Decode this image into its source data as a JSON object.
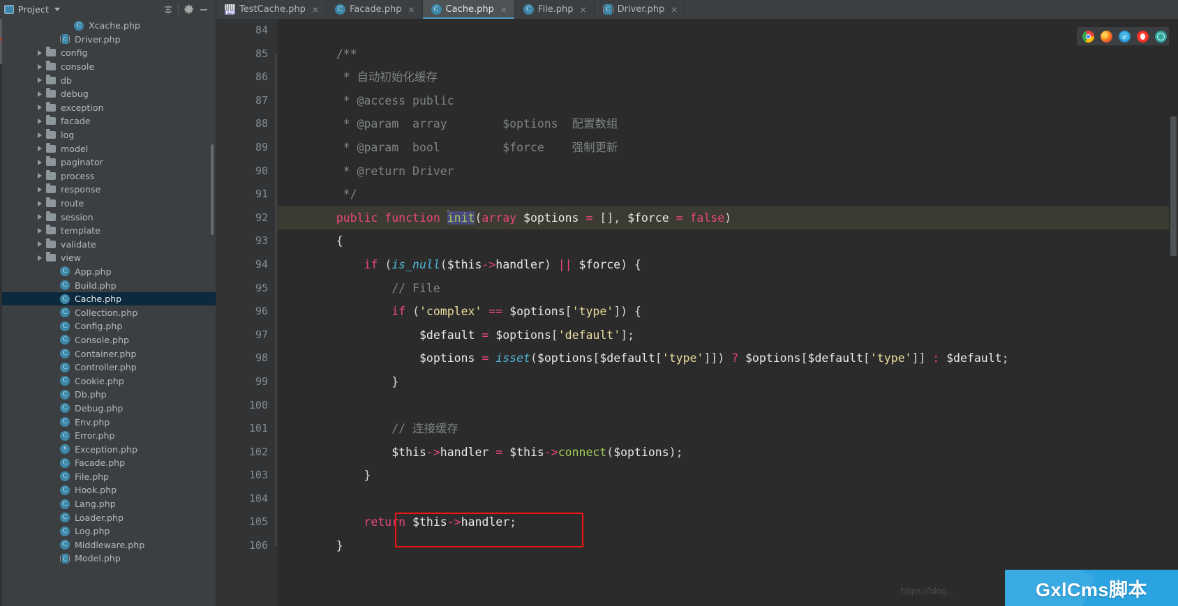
{
  "window": {
    "project_panel": {
      "title": "Project",
      "icon": "project-icon",
      "caret": "chevron-down-icon",
      "buttons": [
        {
          "name": "collapse-all-button",
          "icon": "collapse-all-icon"
        },
        {
          "name": "settings-button",
          "icon": "gear-icon"
        },
        {
          "name": "hide-button",
          "icon": "minus-icon"
        }
      ]
    }
  },
  "tabs": [
    {
      "label": "TestCache.php",
      "icon": "php-file-icon",
      "active": false,
      "close": "×"
    },
    {
      "label": "Facade.php",
      "icon": "php-class-icon",
      "active": false,
      "close": "×"
    },
    {
      "label": "Cache.php",
      "icon": "php-class-icon",
      "active": true,
      "close": "×"
    },
    {
      "label": "File.php",
      "icon": "php-class-icon",
      "active": false,
      "close": "×"
    },
    {
      "label": "Driver.php",
      "icon": "php-abstract-class-icon",
      "active": false,
      "close": "×"
    }
  ],
  "sidebar": {
    "items": [
      {
        "label": "Xcache.php",
        "type": "class",
        "indent": 4,
        "arrow": false,
        "selected": false
      },
      {
        "label": "Driver.php",
        "type": "abstract",
        "indent": 3,
        "arrow": false,
        "selected": false
      },
      {
        "label": "config",
        "type": "folder",
        "indent": 2,
        "arrow": true,
        "selected": false
      },
      {
        "label": "console",
        "type": "folder",
        "indent": 2,
        "arrow": true,
        "selected": false
      },
      {
        "label": "db",
        "type": "folder",
        "indent": 2,
        "arrow": true,
        "selected": false
      },
      {
        "label": "debug",
        "type": "folder",
        "indent": 2,
        "arrow": true,
        "selected": false
      },
      {
        "label": "exception",
        "type": "folder",
        "indent": 2,
        "arrow": true,
        "selected": false
      },
      {
        "label": "facade",
        "type": "folder",
        "indent": 2,
        "arrow": true,
        "selected": false
      },
      {
        "label": "log",
        "type": "folder",
        "indent": 2,
        "arrow": true,
        "selected": false
      },
      {
        "label": "model",
        "type": "folder",
        "indent": 2,
        "arrow": true,
        "selected": false
      },
      {
        "label": "paginator",
        "type": "folder",
        "indent": 2,
        "arrow": true,
        "selected": false
      },
      {
        "label": "process",
        "type": "folder",
        "indent": 2,
        "arrow": true,
        "selected": false
      },
      {
        "label": "response",
        "type": "folder",
        "indent": 2,
        "arrow": true,
        "selected": false
      },
      {
        "label": "route",
        "type": "folder",
        "indent": 2,
        "arrow": true,
        "selected": false
      },
      {
        "label": "session",
        "type": "folder",
        "indent": 2,
        "arrow": true,
        "selected": false
      },
      {
        "label": "template",
        "type": "folder",
        "indent": 2,
        "arrow": true,
        "selected": false
      },
      {
        "label": "validate",
        "type": "folder",
        "indent": 2,
        "arrow": true,
        "selected": false
      },
      {
        "label": "view",
        "type": "folder",
        "indent": 2,
        "arrow": true,
        "selected": false
      },
      {
        "label": "App.php",
        "type": "class",
        "indent": 3,
        "arrow": false,
        "selected": false
      },
      {
        "label": "Build.php",
        "type": "class",
        "indent": 3,
        "arrow": false,
        "selected": false
      },
      {
        "label": "Cache.php",
        "type": "class",
        "indent": 3,
        "arrow": false,
        "selected": true
      },
      {
        "label": "Collection.php",
        "type": "class",
        "indent": 3,
        "arrow": false,
        "selected": false
      },
      {
        "label": "Config.php",
        "type": "class",
        "indent": 3,
        "arrow": false,
        "selected": false
      },
      {
        "label": "Console.php",
        "type": "class",
        "indent": 3,
        "arrow": false,
        "selected": false
      },
      {
        "label": "Container.php",
        "type": "class",
        "indent": 3,
        "arrow": false,
        "selected": false
      },
      {
        "label": "Controller.php",
        "type": "class",
        "indent": 3,
        "arrow": false,
        "selected": false
      },
      {
        "label": "Cookie.php",
        "type": "class",
        "indent": 3,
        "arrow": false,
        "selected": false
      },
      {
        "label": "Db.php",
        "type": "class",
        "indent": 3,
        "arrow": false,
        "selected": false
      },
      {
        "label": "Debug.php",
        "type": "class",
        "indent": 3,
        "arrow": false,
        "selected": false
      },
      {
        "label": "Env.php",
        "type": "class",
        "indent": 3,
        "arrow": false,
        "selected": false
      },
      {
        "label": "Error.php",
        "type": "class",
        "indent": 3,
        "arrow": false,
        "selected": false
      },
      {
        "label": "Exception.php",
        "type": "exception",
        "indent": 3,
        "arrow": false,
        "selected": false
      },
      {
        "label": "Facade.php",
        "type": "class",
        "indent": 3,
        "arrow": false,
        "selected": false
      },
      {
        "label": "File.php",
        "type": "class",
        "indent": 3,
        "arrow": false,
        "selected": false
      },
      {
        "label": "Hook.php",
        "type": "class",
        "indent": 3,
        "arrow": false,
        "selected": false
      },
      {
        "label": "Lang.php",
        "type": "class",
        "indent": 3,
        "arrow": false,
        "selected": false
      },
      {
        "label": "Loader.php",
        "type": "class",
        "indent": 3,
        "arrow": false,
        "selected": false
      },
      {
        "label": "Log.php",
        "type": "class",
        "indent": 3,
        "arrow": false,
        "selected": false
      },
      {
        "label": "Middleware.php",
        "type": "class",
        "indent": 3,
        "arrow": false,
        "selected": false
      },
      {
        "label": "Model.php",
        "type": "abstract",
        "indent": 3,
        "arrow": false,
        "selected": false
      }
    ]
  },
  "editor": {
    "file": "Cache.php",
    "first_line": 84,
    "lines": [
      {
        "num": "84",
        "fold": "",
        "highlight": false,
        "text": ""
      },
      {
        "num": "85",
        "fold": "minus",
        "highlight": false,
        "text": "    /**"
      },
      {
        "num": "86",
        "fold": "",
        "highlight": false,
        "text": "     * 自动初始化缓存"
      },
      {
        "num": "87",
        "fold": "",
        "highlight": false,
        "text": "     * @access public"
      },
      {
        "num": "88",
        "fold": "",
        "highlight": false,
        "text": "     * @param  array        $options  配置数组"
      },
      {
        "num": "89",
        "fold": "",
        "highlight": false,
        "text": "     * @param  bool         $force    强制更新"
      },
      {
        "num": "90",
        "fold": "",
        "highlight": false,
        "text": "     * @return Driver"
      },
      {
        "num": "91",
        "fold": "end",
        "highlight": false,
        "text": "     */"
      },
      {
        "num": "92",
        "fold": "minus",
        "highlight": true,
        "text": "    public function init(array $options = [], $force = false)"
      },
      {
        "num": "93",
        "fold": "",
        "highlight": false,
        "text": "    {"
      },
      {
        "num": "94",
        "fold": "minus",
        "highlight": false,
        "text": "        if (is_null($this->handler) || $force) {"
      },
      {
        "num": "95",
        "fold": "",
        "highlight": false,
        "text": "            // File"
      },
      {
        "num": "96",
        "fold": "minus",
        "highlight": false,
        "text": "            if ('complex' == $options['type']) {"
      },
      {
        "num": "97",
        "fold": "",
        "highlight": false,
        "text": "                $default = $options['default'];"
      },
      {
        "num": "98",
        "fold": "",
        "highlight": false,
        "text": "                $options = isset($options[$default['type']]) ? $options[$default['type']] : $default;"
      },
      {
        "num": "99",
        "fold": "end",
        "highlight": false,
        "text": "            }"
      },
      {
        "num": "100",
        "fold": "",
        "highlight": false,
        "text": ""
      },
      {
        "num": "101",
        "fold": "",
        "highlight": false,
        "text": "            // 连接缓存"
      },
      {
        "num": "102",
        "fold": "",
        "highlight": false,
        "text": "            $this->handler = $this->connect($options);"
      },
      {
        "num": "103",
        "fold": "end",
        "highlight": false,
        "text": "        }"
      },
      {
        "num": "104",
        "fold": "",
        "highlight": false,
        "text": ""
      },
      {
        "num": "105",
        "fold": "",
        "highlight": false,
        "text": "        return $this->handler;"
      },
      {
        "num": "106",
        "fold": "end",
        "highlight": false,
        "text": "    }"
      }
    ],
    "cursor_token": "init",
    "annotation": {
      "name": "red-highlight-box",
      "target_line": "105",
      "color": "#f11414"
    }
  },
  "browsers": [
    {
      "name": "chrome-icon",
      "cls": "b-chrome"
    },
    {
      "name": "firefox-icon",
      "cls": "b-firefox"
    },
    {
      "name": "internet-explorer-icon",
      "cls": "b-ie"
    },
    {
      "name": "opera-icon",
      "cls": "b-opera"
    },
    {
      "name": "safari-icon",
      "cls": "b-safari"
    }
  ],
  "footer": {
    "url": "https://blog...",
    "watermark": "GxlCms脚本"
  }
}
